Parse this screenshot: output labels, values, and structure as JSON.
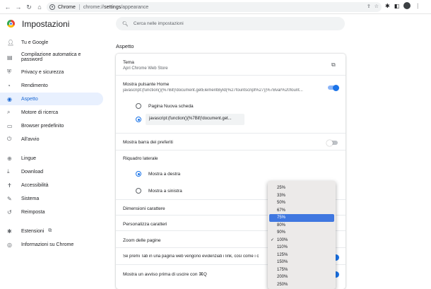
{
  "toolbar": {
    "chip_label": "Chrome",
    "url_host": "chrome://",
    "url_path_bold": "settings",
    "url_rest": "/appearance"
  },
  "header": {
    "title": "Impostazioni",
    "search_placeholder": "Cerca nelle impostazioni"
  },
  "sidebar": {
    "items": [
      {
        "label": "Tu e Google",
        "icon": "person-icon"
      },
      {
        "label": "Compilazione automatica e password",
        "icon": "clipboard-icon"
      },
      {
        "label": "Privacy e sicurezza",
        "icon": "shield-icon"
      },
      {
        "label": "Rendimento",
        "icon": "speedometer-icon"
      },
      {
        "label": "Aspetto",
        "icon": "palette-icon"
      },
      {
        "label": "Motore di ricerca",
        "icon": "search-icon"
      },
      {
        "label": "Browser predefinito",
        "icon": "browser-icon"
      },
      {
        "label": "All'avvio",
        "icon": "power-icon"
      },
      {
        "label": "Lingue",
        "icon": "globe-icon"
      },
      {
        "label": "Download",
        "icon": "download-icon"
      },
      {
        "label": "Accessibilità",
        "icon": "accessibility-icon"
      },
      {
        "label": "Sistema",
        "icon": "wrench-icon"
      },
      {
        "label": "Reimposta",
        "icon": "reset-icon"
      },
      {
        "label": "Estensioni",
        "icon": "puzzle-icon"
      },
      {
        "label": "Informazioni su Chrome",
        "icon": "chrome-icon"
      }
    ],
    "active": "Aspetto"
  },
  "main": {
    "section_title": "Aspetto",
    "theme": {
      "title": "Tema",
      "subtitle": "Apri Chrome Web Store"
    },
    "home_button": {
      "title": "Mostra pulsante Home",
      "subtitle": "javascript:(function(){%7Bif(!document.getElementById(%27fountscript%27))%7Bvar%20fount...",
      "enabled": true,
      "option_new_tab": "Pagina Nuova scheda",
      "option_custom_value": "javascript:(function(){%7Bif(!document.get..."
    },
    "bookmarks_bar": {
      "title": "Mostra barra dei preferiti",
      "enabled": false
    },
    "side_panel": {
      "title": "Riquadro laterale",
      "option_right": "Mostra a destra",
      "option_left": "Mostra a sinistra"
    },
    "font_size": {
      "title": "Dimensioni carattere"
    },
    "customize_fonts": {
      "title": "Personalizza caratteri"
    },
    "page_zoom": {
      "title": "Zoom delle pagine"
    },
    "tab_links": {
      "title": "Se premi Tab in una pagina web vengono evidenziati i link, così come i c",
      "enabled": true
    },
    "quit_warning": {
      "title": "Mostra un avviso prima di uscire con ⌘Q",
      "enabled": true
    }
  },
  "zoom_dropdown": {
    "options": [
      "25%",
      "33%",
      "50%",
      "67%",
      "75%",
      "80%",
      "90%",
      "100%",
      "110%",
      "125%",
      "150%",
      "175%",
      "200%",
      "250%"
    ],
    "checked": "100%",
    "highlighted": "75%",
    "check_glyph": "✓"
  },
  "colors": {
    "accent": "#1a73e8",
    "active_bg": "#e8f0fe",
    "highlight": "#3f77e0"
  }
}
